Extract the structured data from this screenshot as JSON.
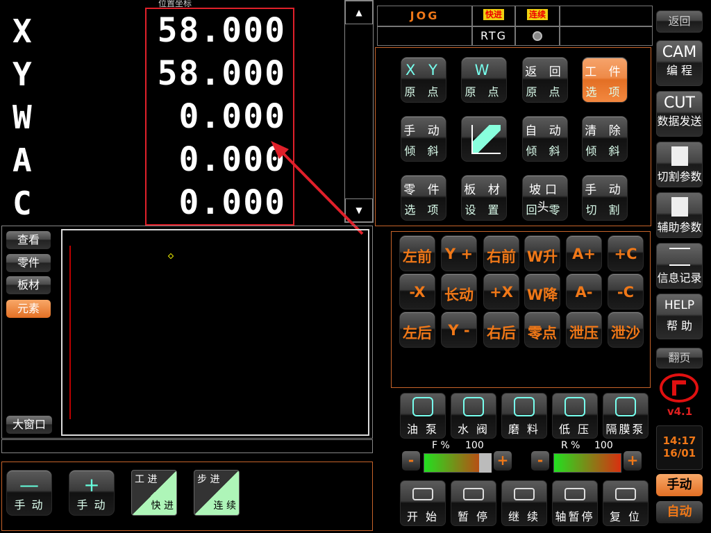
{
  "position": {
    "title": "位置坐标",
    "axes": [
      {
        "axis": "X",
        "value": "58.000"
      },
      {
        "axis": "Y",
        "value": "58.000"
      },
      {
        "axis": "W",
        "value": "0.000"
      },
      {
        "axis": "A",
        "value": "0.000"
      },
      {
        "axis": "C",
        "value": "0.000"
      }
    ]
  },
  "status": {
    "mode": "JOG",
    "fast_badge": "快进",
    "continuous_badge": "连续",
    "rtg": "RTG"
  },
  "function_buttons": [
    {
      "line1": "X Y",
      "line2": "原 点",
      "style": "dark"
    },
    {
      "line1": "W",
      "line2": "原 点",
      "style": "dark"
    },
    {
      "line1": "返 回",
      "line2": "原 点",
      "style": "dark"
    },
    {
      "line1": "工 件",
      "line2": "选 项",
      "style": "orange"
    },
    {
      "line1": "手 动",
      "line2": "倾 斜",
      "style": "dark"
    },
    {
      "line1": "",
      "line2": "",
      "style": "icon"
    },
    {
      "line1": "自 动",
      "line2": "倾 斜",
      "style": "dark"
    },
    {
      "line1": "清 除",
      "line2": "倾 斜",
      "style": "dark"
    },
    {
      "line1": "零 件",
      "line2": "选 项",
      "style": "dark"
    },
    {
      "line1": "板 材",
      "line2": "设 置",
      "style": "dark"
    },
    {
      "line1": "坡口头",
      "line2": "回 零",
      "style": "dark"
    },
    {
      "line1": "手 动",
      "line2": "切 割",
      "style": "dark"
    }
  ],
  "jog_buttons": [
    "左前",
    "Y +",
    "右前",
    "W升",
    "A+",
    "+C",
    "-X",
    "长动",
    "+X",
    "W降",
    "A-",
    "-C",
    "左后",
    "Y -",
    "右后",
    "零点",
    "泄压",
    "泄沙"
  ],
  "side_list": [
    "查看",
    "零件",
    "板材",
    "元素"
  ],
  "big_window": "大窗口",
  "speed_buttons": [
    {
      "top": "—",
      "label": "手 动"
    },
    {
      "top": "+",
      "label": "手 动"
    }
  ],
  "mode_toggles": [
    {
      "top": "工 进",
      "bottom": "快 进"
    },
    {
      "top": "步 进",
      "bottom": "连 续"
    }
  ],
  "pumps": [
    "油 泵",
    "水 阀",
    "磨 料",
    "低 压",
    "隔膜泵"
  ],
  "feed": {
    "f_label": "F %",
    "f_value": "100",
    "r_label": "R %",
    "r_value": "100",
    "minus": "-",
    "plus": "+"
  },
  "controls": [
    "开 始",
    "暂 停",
    "继 续",
    "轴暂停",
    "复 位"
  ],
  "right_column": {
    "back": "返回",
    "cam_big": "CAM",
    "cam_small": "编 程",
    "cut_big": "CUT",
    "cut_small": "数据发送",
    "cut_params": "切割参数",
    "aux_params": "辅助参数",
    "info_log": "信息记录",
    "help_big": "HELP",
    "help_small": "帮 助",
    "page": "翻页",
    "version": "v4.1",
    "time": "14:17",
    "date": "16/01",
    "manual": "手动",
    "auto": "自动"
  },
  "colors": {
    "accent_orange": "#f07818",
    "highlight_box": "#e0202a",
    "badge_yellow": "#f0d010"
  }
}
